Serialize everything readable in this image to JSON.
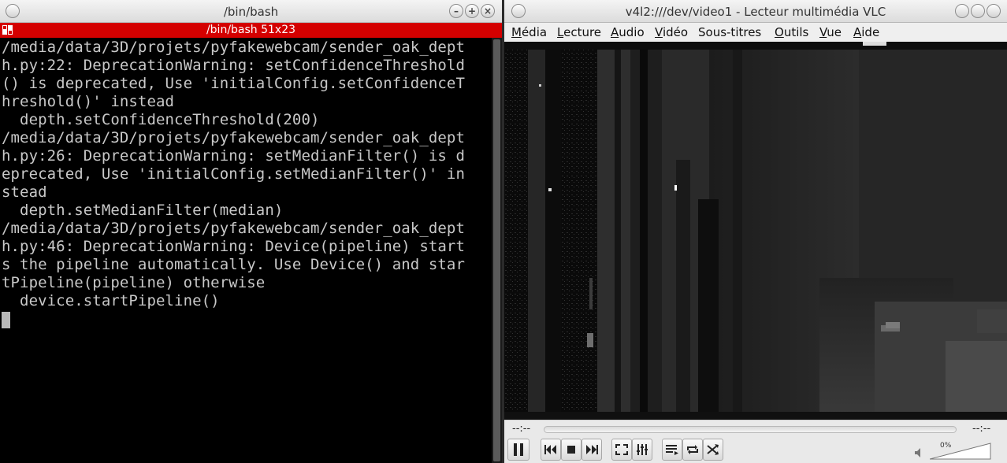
{
  "terminal": {
    "window_title": "/bin/bash",
    "tab_title": "/bin/bash 51x23",
    "lines": [
      "/media/data/3D/projets/pyfakewebcam/sender_oak_dept",
      "h.py:22: DeprecationWarning: setConfidenceThreshold",
      "() is deprecated, Use 'initialConfig.setConfidenceT",
      "hreshold()' instead",
      "  depth.setConfidenceThreshold(200)",
      "/media/data/3D/projets/pyfakewebcam/sender_oak_dept",
      "h.py:26: DeprecationWarning: setMedianFilter() is d",
      "eprecated, Use 'initialConfig.setMedianFilter()' in",
      "stead",
      "  depth.setMedianFilter(median)",
      "/media/data/3D/projets/pyfakewebcam/sender_oak_dept",
      "h.py:46: DeprecationWarning: Device(pipeline) start",
      "s the pipeline automatically. Use Device() and star",
      "tPipeline(pipeline) otherwise",
      "  device.startPipeline()"
    ],
    "buttons": {
      "minimize": "–",
      "maximize": "+",
      "close": "×"
    }
  },
  "vlc": {
    "window_title": "v4l2:///dev/video1 - Lecteur multimédia VLC",
    "menu": [
      {
        "label": "Média",
        "u": "M",
        "rest": "édia"
      },
      {
        "label": "Lecture",
        "u": "L",
        "rest": "ecture"
      },
      {
        "label": "Audio",
        "u": "A",
        "rest": "udio"
      },
      {
        "label": "Vidéo",
        "u": "V",
        "rest": "idéo"
      },
      {
        "label": "Sous-titres",
        "u": "",
        "rest": "Sous-titres"
      },
      {
        "label": "Outils",
        "u": "O",
        "rest": "utils"
      },
      {
        "label": "Vue",
        "u": "V",
        "rest": "ue"
      },
      {
        "label": "Aide",
        "u": "A",
        "rest": "ide"
      }
    ],
    "time_elapsed": "--:--",
    "time_total": "--:--",
    "volume": "0%",
    "controls": [
      "pause-icon",
      "previous-icon",
      "stop-icon",
      "next-icon",
      "fullscreen-icon",
      "extended-settings-icon",
      "playlist-icon",
      "loop-icon",
      "shuffle-icon"
    ],
    "colors": {
      "accent": "#d40000"
    }
  }
}
